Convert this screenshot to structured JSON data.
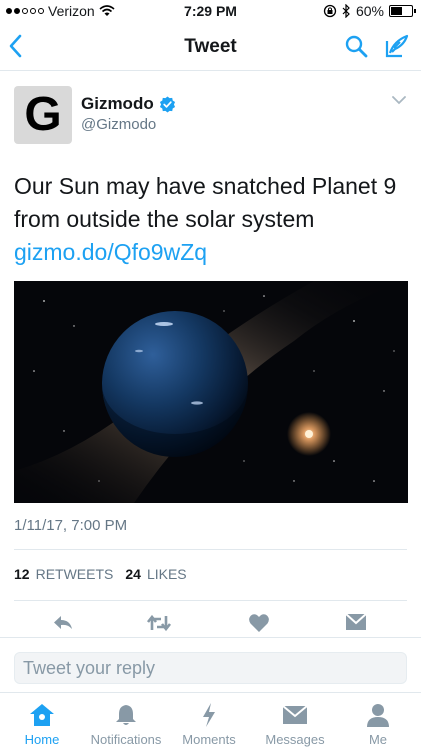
{
  "status_bar": {
    "carrier": "Verizon",
    "time": "7:29 PM",
    "battery": "60%",
    "battery_level": 0.6
  },
  "nav": {
    "title": "Tweet"
  },
  "tweet": {
    "author_name": "Gizmodo",
    "author_handle": "@Gizmodo",
    "avatar_letter": "G",
    "text_main": "Our Sun may have snatched Planet 9 from outside the solar system ",
    "link_text": "gizmo.do/Qfo9wZq",
    "timestamp": "1/11/17, 7:00 PM",
    "retweet_count": "12",
    "retweets_label": "RETWEETS",
    "like_count": "24",
    "likes_label": "LIKES"
  },
  "reply": {
    "placeholder": "Tweet your reply"
  },
  "tabbar": {
    "items": [
      {
        "label": "Home",
        "icon": "home-icon"
      },
      {
        "label": "Notifications",
        "icon": "bell-icon"
      },
      {
        "label": "Moments",
        "icon": "lightning-icon"
      },
      {
        "label": "Messages",
        "icon": "envelope-icon"
      },
      {
        "label": "Me",
        "icon": "person-icon"
      }
    ]
  },
  "colors": {
    "accent": "#1da1f2",
    "text": "#14171a",
    "muted": "#657786",
    "tab_inactive": "#8899a6"
  }
}
